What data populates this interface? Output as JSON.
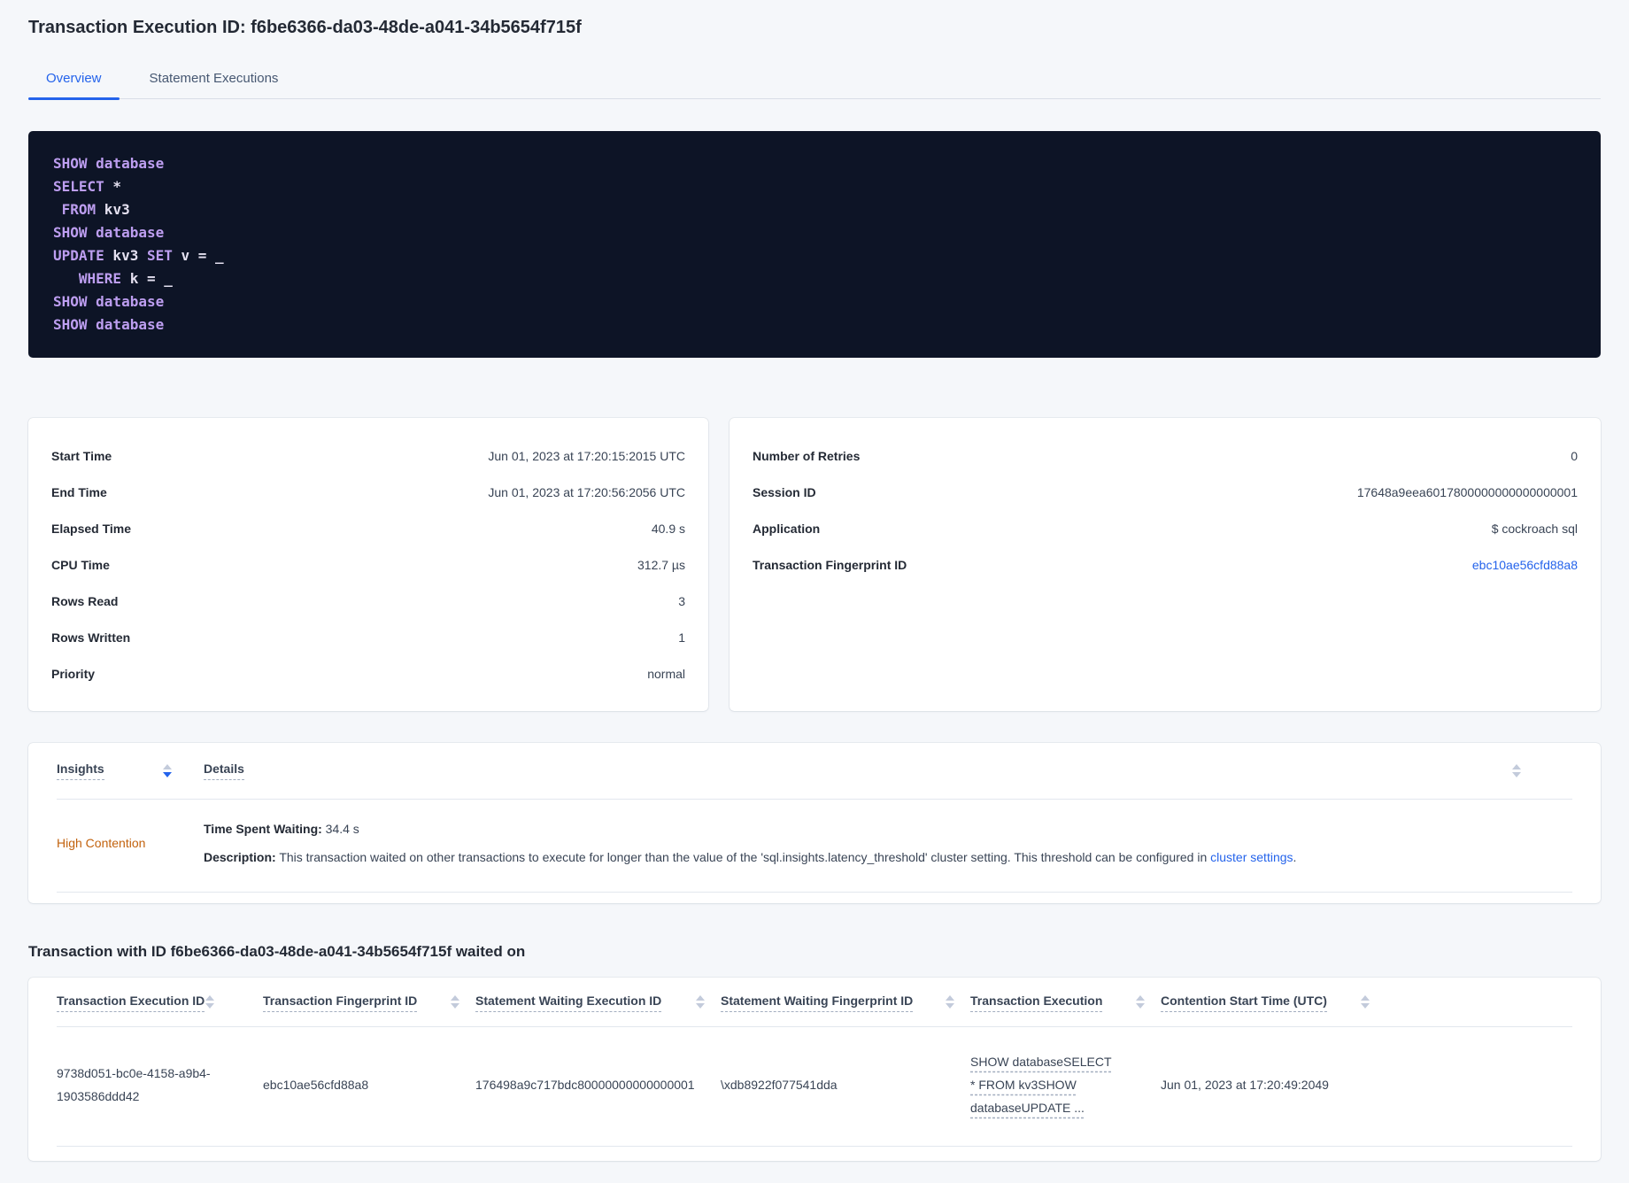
{
  "page": {
    "title": "Transaction Execution ID: f6be6366-da03-48de-a041-34b5654f715f"
  },
  "tabs": [
    {
      "label": "Overview",
      "active": true
    },
    {
      "label": "Statement Executions",
      "active": false
    }
  ],
  "sql_box": {
    "lines": [
      [
        {
          "t": "SHOW database",
          "kw": true
        }
      ],
      [
        {
          "t": "SELECT",
          "kw": true
        },
        {
          "t": " *",
          "kw": false
        }
      ],
      [
        {
          "t": " FROM",
          "kw": true
        },
        {
          "t": " kv3",
          "kw": false
        }
      ],
      [
        {
          "t": "SHOW database",
          "kw": true
        }
      ],
      [
        {
          "t": "UPDATE",
          "kw": true
        },
        {
          "t": " kv3 ",
          "kw": false
        },
        {
          "t": "SET",
          "kw": true
        },
        {
          "t": " v = _",
          "kw": false
        }
      ],
      [
        {
          "t": "   WHERE",
          "kw": true
        },
        {
          "t": " k = _",
          "kw": false
        }
      ],
      [
        {
          "t": "SHOW database",
          "kw": true
        }
      ],
      [
        {
          "t": "SHOW database",
          "kw": true
        }
      ]
    ]
  },
  "details_card": {
    "rows": [
      {
        "label": "Start Time",
        "value": "Jun 01, 2023 at 17:20:15:2015 UTC",
        "link": false
      },
      {
        "label": "End Time",
        "value": "Jun 01, 2023 at 17:20:56:2056 UTC",
        "link": false
      },
      {
        "label": "Elapsed Time",
        "value": "40.9 s",
        "link": false
      },
      {
        "label": "CPU Time",
        "value": "312.7 µs",
        "link": false
      },
      {
        "label": "Rows Read",
        "value": "3",
        "link": false
      },
      {
        "label": "Rows Written",
        "value": "1",
        "link": false
      },
      {
        "label": "Priority",
        "value": "normal",
        "link": false
      }
    ]
  },
  "meta_card": {
    "rows": [
      {
        "label": "Number of Retries",
        "value": "0",
        "link": false
      },
      {
        "label": "Session ID",
        "value": "17648a9eea6017800000000000000001",
        "link": false
      },
      {
        "label": "Application",
        "value": "$ cockroach sql",
        "link": false
      },
      {
        "label": "Transaction Fingerprint ID",
        "value": "ebc10ae56cfd88a8",
        "link": true
      }
    ]
  },
  "insights": {
    "columns": {
      "insights": "Insights",
      "details": "Details"
    },
    "sort_direction": "desc",
    "row": {
      "insight": "High Contention",
      "waiting_label": "Time Spent Waiting:",
      "waiting_value": " 34.4 s",
      "description_label": "Description:",
      "description_text": " This transaction waited on other transactions to execute for longer than the value of the 'sql.insights.latency_threshold' cluster setting. This threshold can be configured in ",
      "description_link": "cluster settings",
      "description_suffix": "."
    }
  },
  "waited_on": {
    "heading": "Transaction with ID f6be6366-da03-48de-a041-34b5654f715f waited on",
    "columns": [
      "Transaction Execution ID",
      "Transaction Fingerprint ID",
      "Statement Waiting Execution ID",
      "Statement Waiting Fingerprint ID",
      "Transaction Execution",
      "Contention Start Time (UTC)"
    ],
    "row": {
      "transaction_execution_id": "9738d051-bc0e-4158-a9b4-1903586ddd42",
      "transaction_fingerprint_id": "ebc10ae56cfd88a8",
      "statement_waiting_execution_id": "176498a9c717bdc80000000000000001",
      "statement_waiting_fingerprint_id": "\\xdb8922f077541dda",
      "transaction_execution": "SHOW databaseSELECT * FROM kv3SHOW databaseUPDATE ...",
      "contention_start_time": "Jun 01, 2023 at 17:20:49:2049"
    }
  },
  "colors": {
    "accent_blue": "#2463eb",
    "insight_orange": "#c2620d",
    "code_background": "#0d1426",
    "code_keyword": "#bd9ef0",
    "code_text": "#e4e0f0",
    "page_background": "#f5f7fa"
  }
}
